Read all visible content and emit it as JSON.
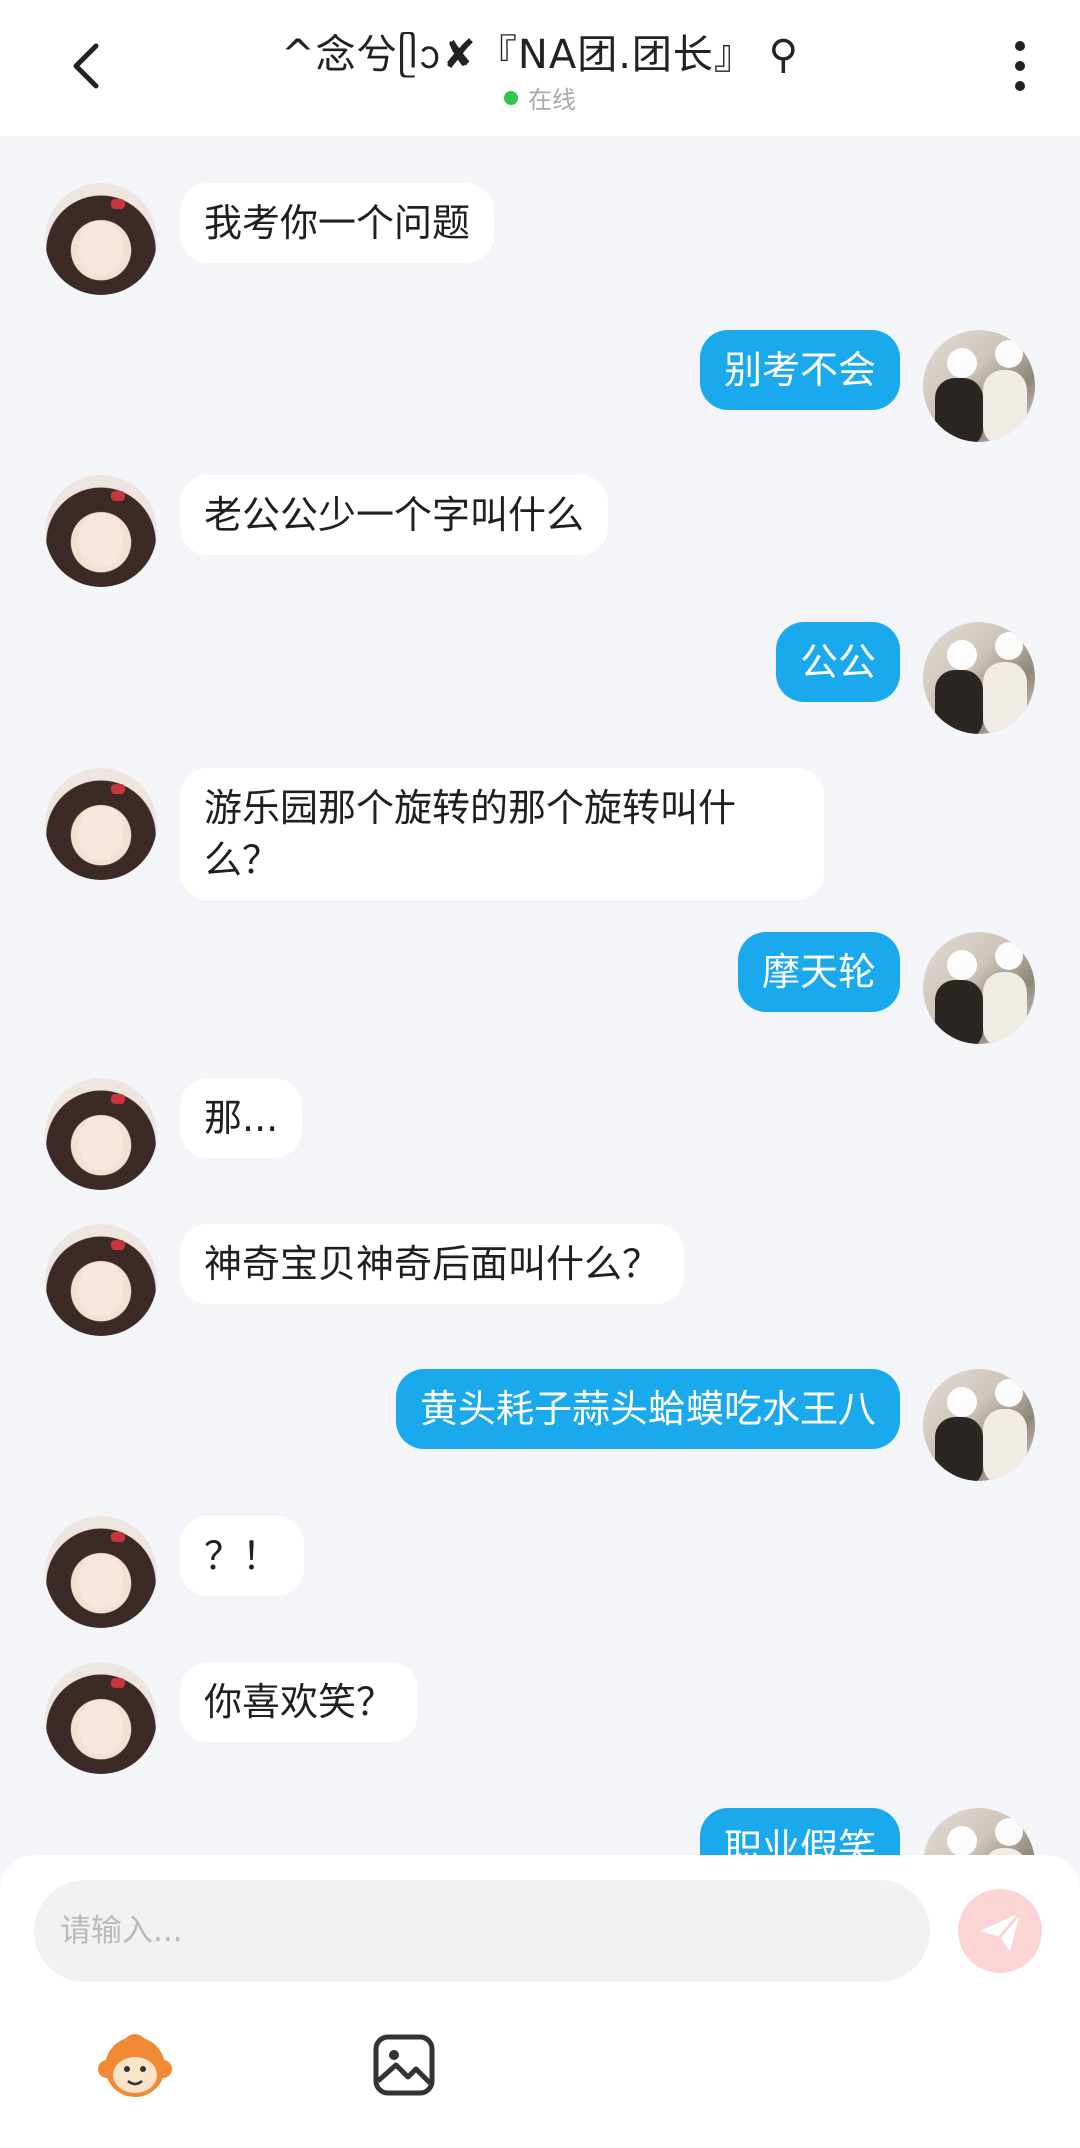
{
  "header": {
    "title": "^念兮ᥫᩣ✘『NA团.团长』 ⚲",
    "status": "在线",
    "status_color": "#2ec64b"
  },
  "messages": [
    {
      "side": "left",
      "text": "我考你一个问题"
    },
    {
      "side": "right",
      "text": "别考不会"
    },
    {
      "side": "left",
      "text": "老公公少一个字叫什么"
    },
    {
      "side": "right",
      "text": "公公"
    },
    {
      "side": "left",
      "text": "游乐园那个旋转的那个旋转叫什\n么？"
    },
    {
      "side": "right",
      "text": "摩天轮"
    },
    {
      "side": "left",
      "text": "那..."
    },
    {
      "side": "left",
      "text": "神奇宝贝神奇后面叫什么？"
    },
    {
      "side": "right",
      "text": "黄头耗子蒜头蛤蟆吃水王八"
    },
    {
      "side": "left",
      "text": "？！"
    },
    {
      "side": "left",
      "text": "你喜欢笑？"
    },
    {
      "side": "right",
      "text": "职业假笑"
    }
  ],
  "composer": {
    "placeholder": "请输入...",
    "send_icon": "paper-plane-icon",
    "tools": [
      "monkey-sticker-icon",
      "image-icon"
    ]
  },
  "colors": {
    "outgoing_bubble": "#1ba9ee",
    "incoming_bubble": "#ffffff",
    "background": "#f4f5f8"
  }
}
